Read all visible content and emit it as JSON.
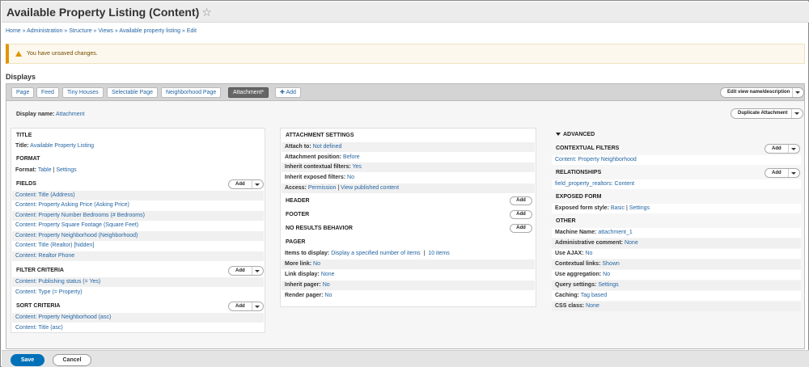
{
  "title": "Available Property Listing (Content)",
  "breadcrumb": "Home » Administration » Structure » Views » Available property listing » Edit",
  "message": "You have unsaved changes.",
  "displays_label": "Displays",
  "tabs": [
    "Page",
    "Feed",
    "Tiny Houses",
    "Selectable Page",
    "Neighborhood Page",
    "Attachment*"
  ],
  "add_display": "Add",
  "edit_view_btn": "Edit view name/description",
  "display_name_label": "Display name:",
  "display_name_value": "Attachment",
  "duplicate_btn": "Duplicate Attachment",
  "add_label": "Add",
  "left": {
    "title_section": "TITLE",
    "title_label": "Title:",
    "title_value": "Available Property Listing",
    "format_section": "FORMAT",
    "format_label": "Format:",
    "format_value": "Table",
    "format_settings": "Settings",
    "fields_section": "FIELDS",
    "fields": [
      "Content: Title (Address)",
      "Content: Property Asking Price (Asking Price)",
      "Content: Property Number Bedrooms (# Bedrooms)",
      "Content: Property Square Footage (Square Feet)",
      "Content: Property Neighborhood (Neighborhood)",
      "Content: Title (Realtor) [hidden]",
      "Content: Realtor Phone"
    ],
    "filter_section": "FILTER CRITERIA",
    "filters": [
      "Content: Publishing status (= Yes)",
      "Content: Type (= Property)"
    ],
    "sort_section": "SORT CRITERIA",
    "sorts": [
      "Content: Property Neighborhood (asc)",
      "Content: Title (asc)"
    ]
  },
  "middle": {
    "attachment_section": "ATTACHMENT SETTINGS",
    "attach_to_label": "Attach to:",
    "attach_to_value": "Not defined",
    "position_label": "Attachment position:",
    "position_value": "Before",
    "inherit_ctx_label": "Inherit contextual filters:",
    "inherit_ctx_value": "Yes",
    "inherit_exp_label": "Inherit exposed filters:",
    "inherit_exp_value": "No",
    "access_label": "Access:",
    "access_value": "Permission",
    "access_value2": "View published content",
    "header_section": "HEADER",
    "footer_section": "FOOTER",
    "noresults_section": "NO RESULTS BEHAVIOR",
    "pager_section": "PAGER",
    "items_label": "Items to display:",
    "items_value": "Display a specified number of items",
    "items_value2": "10 items",
    "more_label": "More link:",
    "more_value": "No",
    "link_label": "Link display:",
    "link_value": "None",
    "inherit_pager_label": "Inherit pager:",
    "inherit_pager_value": "No",
    "render_pager_label": "Render pager:",
    "render_pager_value": "No"
  },
  "right": {
    "advanced": "ADVANCED",
    "contextual_section": "CONTEXTUAL FILTERS",
    "contextual_value": "Content: Property Neighborhood",
    "relationships_section": "RELATIONSHIPS",
    "relationships_value": "field_property_realtors: Content",
    "exposed_section": "EXPOSED FORM",
    "exposed_label": "Exposed form style:",
    "exposed_value": "Basic",
    "exposed_settings": "Settings",
    "other_section": "OTHER",
    "machine_label": "Machine Name:",
    "machine_value": "attachment_1",
    "admin_label": "Administrative comment:",
    "admin_value": "None",
    "ajax_label": "Use AJAX:",
    "ajax_value": "No",
    "ctxlinks_label": "Contextual links:",
    "ctxlinks_value": "Shown",
    "agg_label": "Use aggregation:",
    "agg_value": "No",
    "query_label": "Query settings:",
    "query_value": "Settings",
    "caching_label": "Caching:",
    "caching_value": "Tag based",
    "css_label": "CSS class:",
    "css_value": "None"
  },
  "save_btn": "Save",
  "cancel_btn": "Cancel"
}
